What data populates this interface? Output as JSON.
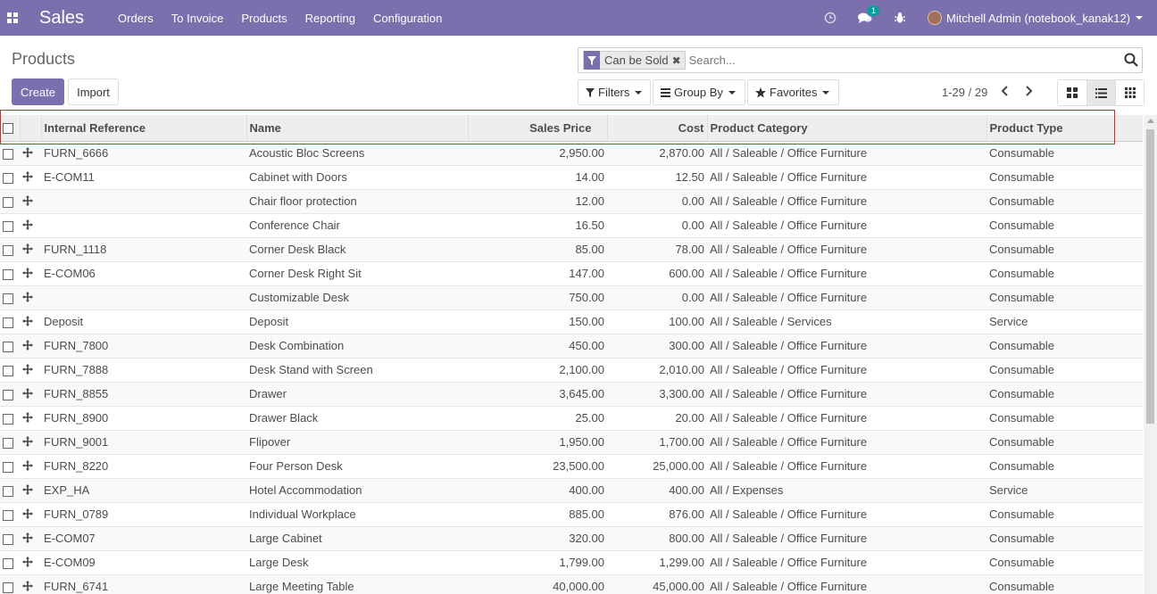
{
  "navbar": {
    "brand": "Sales",
    "menu": [
      "Orders",
      "To Invoice",
      "Products",
      "Reporting",
      "Configuration"
    ],
    "messages_badge": "1",
    "user": "Mitchell Admin (notebook_kanak12)"
  },
  "page": {
    "title": "Products",
    "create_label": "Create",
    "import_label": "Import"
  },
  "search": {
    "facet": "Can be Sold",
    "placeholder": "Search...",
    "filters_label": "Filters",
    "groupby_label": "Group By",
    "favorites_label": "Favorites"
  },
  "pager": {
    "value": "1-29 / 29"
  },
  "table": {
    "columns": [
      "Internal Reference",
      "Name",
      "Sales Price",
      "Cost",
      "Product Category",
      "Product Type"
    ],
    "rows": [
      [
        "FURN_6666",
        "Acoustic Bloc Screens",
        "2,950.00",
        "2,870.00",
        "All / Saleable / Office Furniture",
        "Consumable"
      ],
      [
        "E-COM11",
        "Cabinet with Doors",
        "14.00",
        "12.50",
        "All / Saleable / Office Furniture",
        "Consumable"
      ],
      [
        "",
        "Chair floor protection",
        "12.00",
        "0.00",
        "All / Saleable / Office Furniture",
        "Consumable"
      ],
      [
        "",
        "Conference Chair",
        "16.50",
        "0.00",
        "All / Saleable / Office Furniture",
        "Consumable"
      ],
      [
        "FURN_1118",
        "Corner Desk Black",
        "85.00",
        "78.00",
        "All / Saleable / Office Furniture",
        "Consumable"
      ],
      [
        "E-COM06",
        "Corner Desk Right Sit",
        "147.00",
        "600.00",
        "All / Saleable / Office Furniture",
        "Consumable"
      ],
      [
        "",
        "Customizable Desk",
        "750.00",
        "0.00",
        "All / Saleable / Office Furniture",
        "Consumable"
      ],
      [
        "Deposit",
        "Deposit",
        "150.00",
        "100.00",
        "All / Saleable / Services",
        "Service"
      ],
      [
        "FURN_7800",
        "Desk Combination",
        "450.00",
        "300.00",
        "All / Saleable / Office Furniture",
        "Consumable"
      ],
      [
        "FURN_7888",
        "Desk Stand with Screen",
        "2,100.00",
        "2,010.00",
        "All / Saleable / Office Furniture",
        "Consumable"
      ],
      [
        "FURN_8855",
        "Drawer",
        "3,645.00",
        "3,300.00",
        "All / Saleable / Office Furniture",
        "Consumable"
      ],
      [
        "FURN_8900",
        "Drawer Black",
        "25.00",
        "20.00",
        "All / Saleable / Office Furniture",
        "Consumable"
      ],
      [
        "FURN_9001",
        "Flipover",
        "1,950.00",
        "1,700.00",
        "All / Saleable / Office Furniture",
        "Consumable"
      ],
      [
        "FURN_8220",
        "Four Person Desk",
        "23,500.00",
        "25,000.00",
        "All / Saleable / Office Furniture",
        "Consumable"
      ],
      [
        "EXP_HA",
        "Hotel Accommodation",
        "400.00",
        "400.00",
        "All / Expenses",
        "Service"
      ],
      [
        "FURN_0789",
        "Individual Workplace",
        "885.00",
        "876.00",
        "All / Saleable / Office Furniture",
        "Consumable"
      ],
      [
        "E-COM07",
        "Large Cabinet",
        "320.00",
        "800.00",
        "All / Saleable / Office Furniture",
        "Consumable"
      ],
      [
        "E-COM09",
        "Large Desk",
        "1,799.00",
        "1,299.00",
        "All / Saleable / Office Furniture",
        "Consumable"
      ],
      [
        "FURN_6741",
        "Large Meeting Table",
        "40,000.00",
        "45,000.00",
        "All / Saleable / Office Furniture",
        "Consumable"
      ]
    ]
  },
  "colors": {
    "brand": "#7c6fae",
    "highlight": "#d9262b"
  }
}
